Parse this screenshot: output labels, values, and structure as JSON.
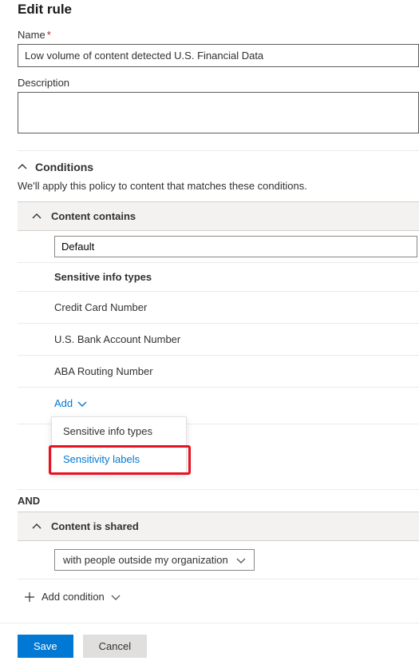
{
  "page_title": "Edit rule",
  "name_field": {
    "label": "Name",
    "required_mark": "*",
    "value": "Low volume of content detected U.S. Financial Data"
  },
  "description_field": {
    "label": "Description",
    "value": ""
  },
  "conditions_section": {
    "title": "Conditions",
    "description": "We'll apply this policy to content that matches these conditions."
  },
  "content_contains": {
    "title": "Content contains",
    "group_name": "Default",
    "subhead": "Sensitive info types",
    "items": [
      "Credit Card Number",
      "U.S. Bank Account Number",
      "ABA Routing Number"
    ],
    "add_label": "Add",
    "menu": {
      "option1": "Sensitive info types",
      "option2": "Sensitivity labels"
    }
  },
  "connector": "AND",
  "content_shared": {
    "title": "Content is shared",
    "selected": "with people outside my organization"
  },
  "add_condition_label": "Add condition",
  "footer": {
    "save": "Save",
    "cancel": "Cancel"
  }
}
